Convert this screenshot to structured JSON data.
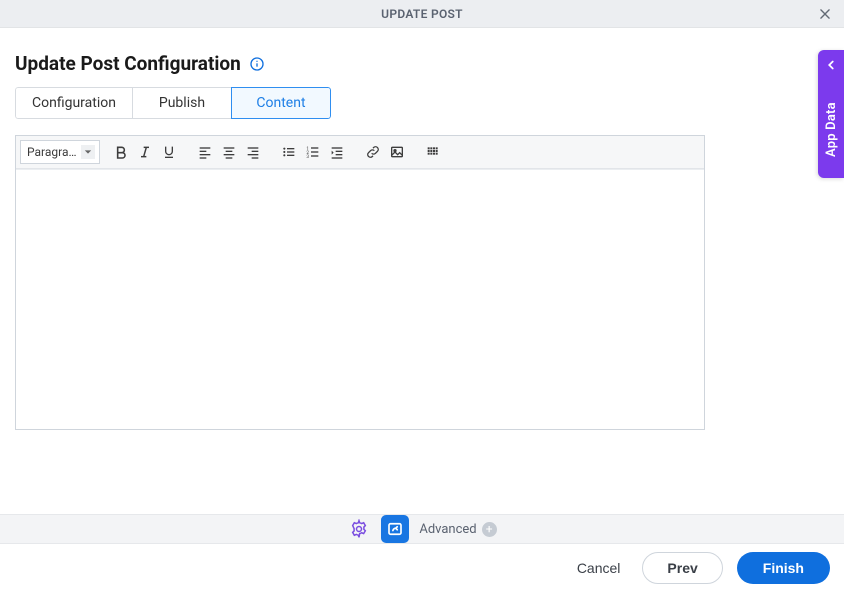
{
  "titlebar": {
    "title": "UPDATE POST"
  },
  "heading": "Update Post Configuration",
  "tabs": [
    {
      "label": "Configuration",
      "active": false
    },
    {
      "label": "Publish",
      "active": false
    },
    {
      "label": "Content",
      "active": true
    }
  ],
  "editor": {
    "format_select": "Paragra...",
    "content": ""
  },
  "side_drawer": {
    "label": "App Data"
  },
  "bottom_bar": {
    "advanced_label": "Advanced"
  },
  "footer": {
    "cancel": "Cancel",
    "prev": "Prev",
    "finish": "Finish"
  },
  "colors": {
    "accent_blue": "#0f6fde",
    "accent_purple": "#7c3aed"
  }
}
